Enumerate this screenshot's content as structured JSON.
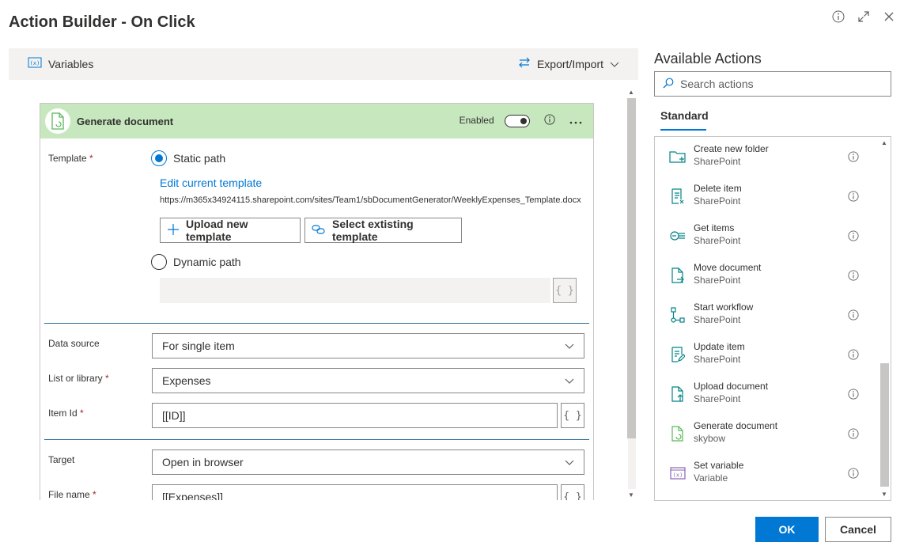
{
  "title": "Action Builder - On Click",
  "toolbar": {
    "variables_label": "Variables",
    "export_label": "Export/Import"
  },
  "card": {
    "title": "Generate document",
    "enabled_label": "Enabled",
    "accent": "#c7e7bf",
    "template_label": "Template",
    "static_path_label": "Static path",
    "edit_template_link": "Edit current template",
    "template_url": "https://m365x34924115.sharepoint.com/sites/Team1/sbDocumentGenerator/WeeklyExpenses_Template.docx",
    "upload_button": "Upload new template",
    "select_button": "Select extisting template",
    "dynamic_path_label": "Dynamic path",
    "fx_glyph": "{ }",
    "data_source_label": "Data source",
    "data_source_value": "For single item",
    "list_label": "List or library",
    "list_value": "Expenses",
    "item_id_label": "Item Id",
    "item_id_value": "[[ID]]",
    "target_label": "Target",
    "target_value": "Open in browser",
    "file_name_label": "File name",
    "file_name_value": "[[Expenses]]",
    "required_mark": "*"
  },
  "panel": {
    "title": "Available Actions",
    "search_placeholder": "Search actions",
    "tab_standard": "Standard",
    "actions": [
      {
        "name": "Create new folder",
        "source": "SharePoint",
        "icon": "folder-add-icon"
      },
      {
        "name": "Delete item",
        "source": "SharePoint",
        "icon": "delete-item-icon"
      },
      {
        "name": "Get items",
        "source": "SharePoint",
        "icon": "get-items-icon"
      },
      {
        "name": "Move document",
        "source": "SharePoint",
        "icon": "move-document-icon"
      },
      {
        "name": "Start workflow",
        "source": "SharePoint",
        "icon": "workflow-icon"
      },
      {
        "name": "Update item",
        "source": "SharePoint",
        "icon": "update-item-icon"
      },
      {
        "name": "Upload document",
        "source": "SharePoint",
        "icon": "upload-document-icon"
      },
      {
        "name": "Generate document",
        "source": "skybow",
        "icon": "generate-document-icon"
      },
      {
        "name": "Set variable",
        "source": "Variable",
        "icon": "variable-icon"
      }
    ]
  },
  "footer": {
    "ok_label": "OK",
    "cancel_label": "Cancel"
  },
  "colors": {
    "primary": "#0078d4",
    "header_green": "#c7e7bf",
    "sharepoint_teal": "#038387",
    "skybow_green": "#5bb75b",
    "variable_purple": "#8764b8"
  }
}
